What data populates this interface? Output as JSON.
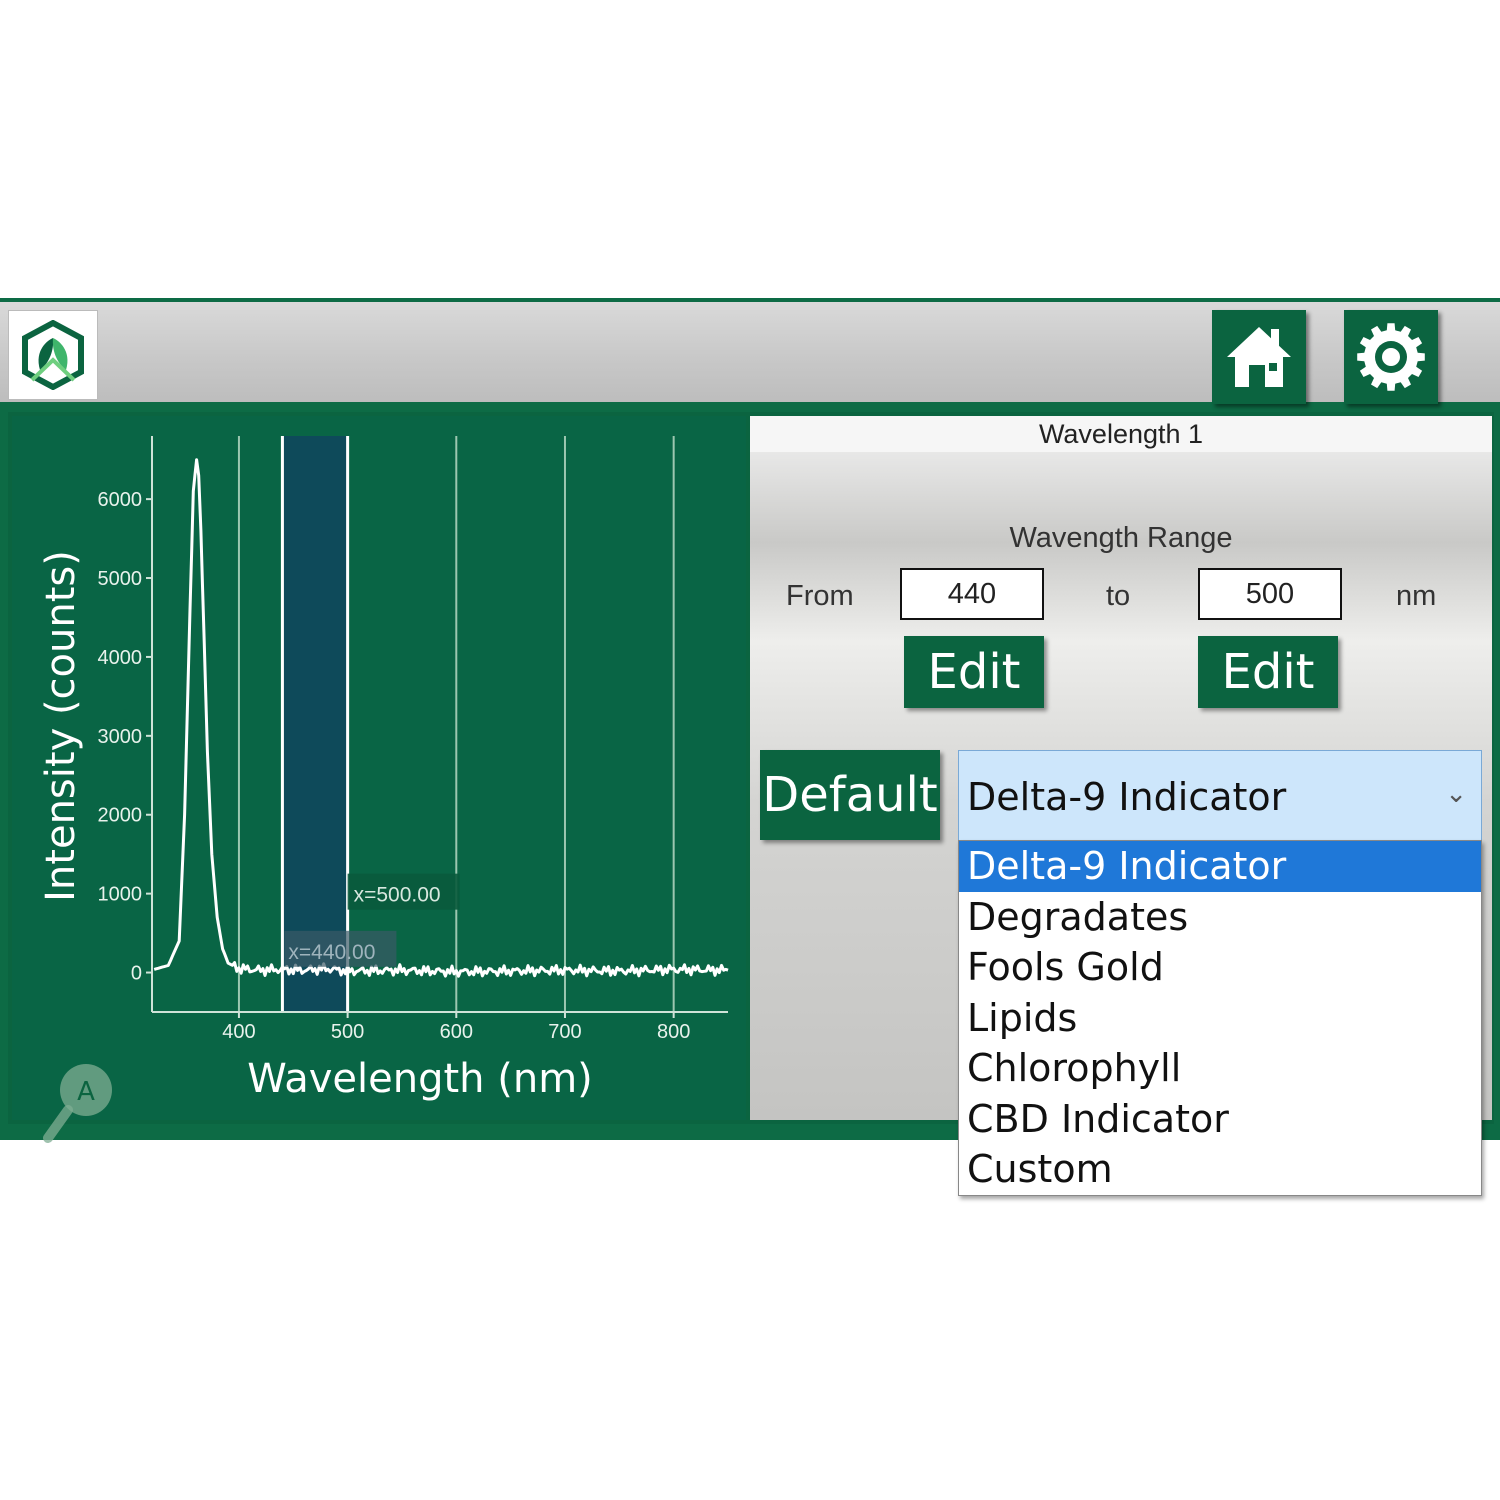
{
  "colors": {
    "brand_green": "#0b6440",
    "chart_bg": "#096545",
    "band": "#0e4a5a",
    "selected_option": "#1f78d8"
  },
  "header": {
    "logo_icon": "leaf-hexagon-icon",
    "home_icon": "home-icon",
    "settings_icon": "gear-icon"
  },
  "panel": {
    "title": "Wavelength 1",
    "range_title": "Wavength Range",
    "from_label": "From",
    "to_label": "to",
    "unit_label": "nm",
    "from_value": "440",
    "to_value": "500",
    "edit_label": "Edit",
    "default_label": "Default",
    "selected": "Delta-9 Indicator",
    "options": [
      "Delta-9 Indicator",
      "Degradates",
      "Fools Gold",
      "Lipids",
      "Chlorophyll",
      "CBD Indicator",
      "Custom"
    ]
  },
  "chart_data": {
    "type": "line",
    "xlabel": "Wavelength (nm)",
    "ylabel": "Intensity (counts)",
    "xlim": [
      320,
      850
    ],
    "ylim": [
      -500,
      6800
    ],
    "x_ticks": [
      400,
      500,
      600,
      700,
      800
    ],
    "y_ticks": [
      0,
      1000,
      2000,
      3000,
      4000,
      5000,
      6000
    ],
    "highlight_band": [
      440,
      500
    ],
    "band_labels": [
      "x=500.00",
      "x=440.00"
    ],
    "series": [
      {
        "x": [
          322,
          335,
          345,
          350,
          355,
          358,
          361,
          363,
          365,
          368,
          371,
          375,
          380,
          385,
          390,
          400,
          420,
          440,
          460,
          480,
          500,
          550,
          600,
          650,
          700,
          750,
          800,
          850
        ],
        "y": [
          40,
          90,
          400,
          2000,
          4600,
          6100,
          6500,
          6300,
          5600,
          4200,
          2800,
          1500,
          700,
          300,
          120,
          50,
          30,
          40,
          30,
          50,
          20,
          30,
          10,
          20,
          30,
          20,
          40,
          30
        ]
      }
    ]
  },
  "zoom_icon": "magnifier-icon"
}
